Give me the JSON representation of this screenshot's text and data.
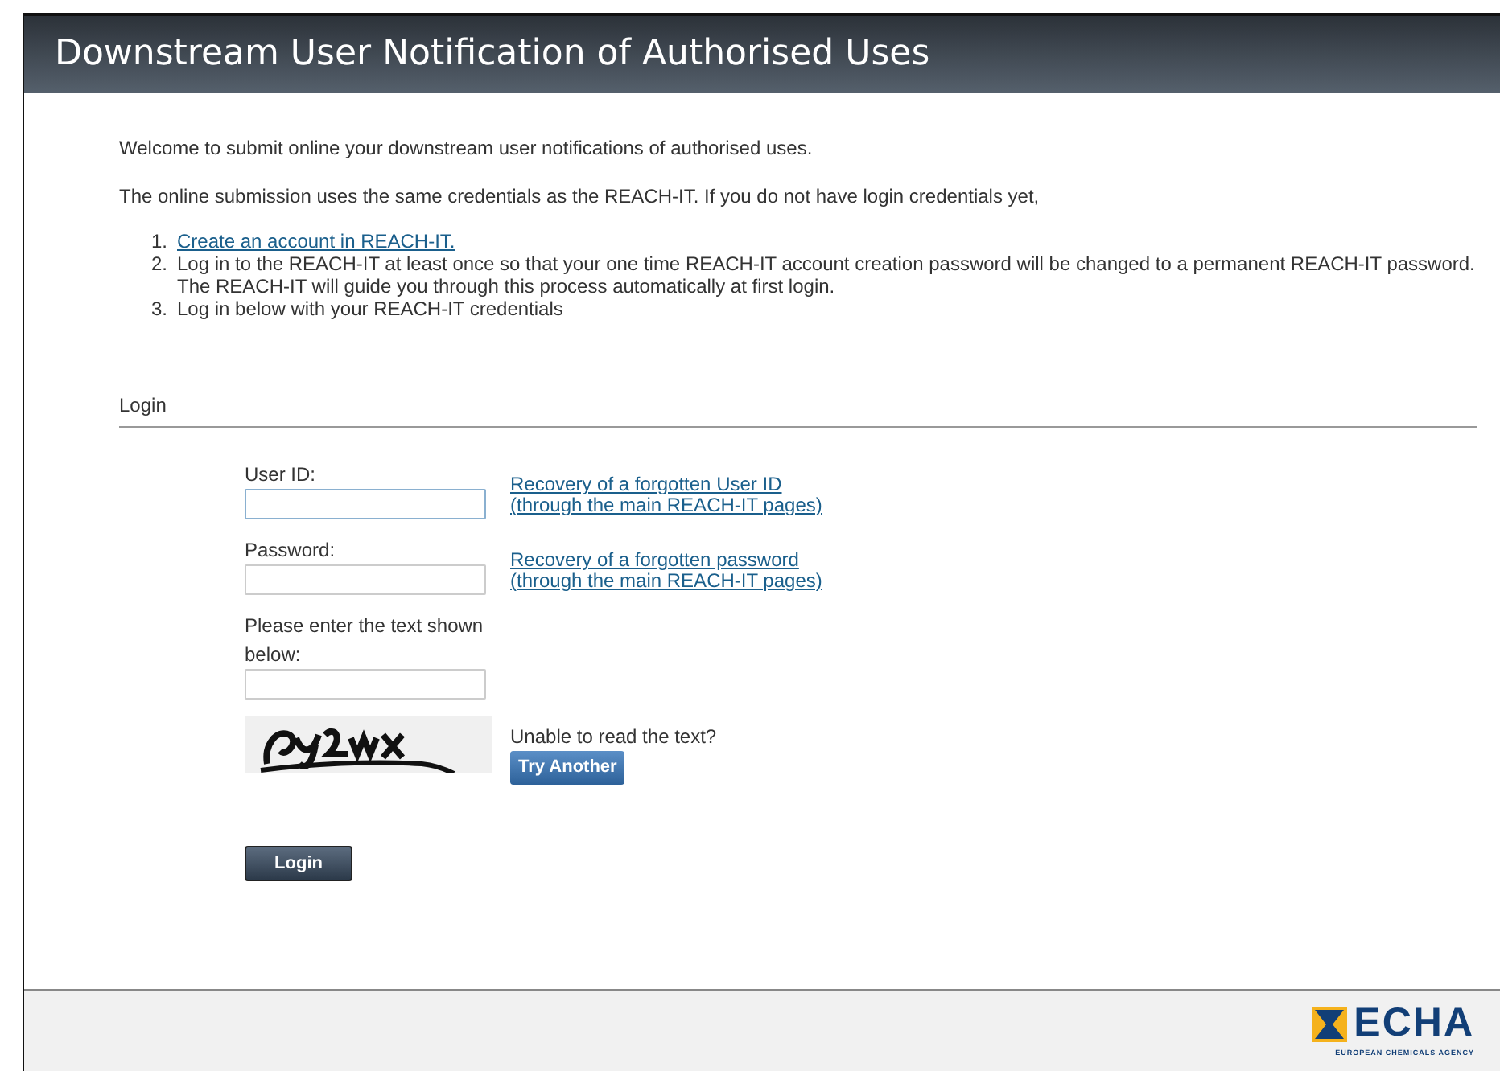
{
  "header": {
    "title": "Downstream User Notification of Authorised Uses"
  },
  "intro": [
    "Welcome to submit online your downstream user notifications of authorised uses.",
    "The online submission uses the same credentials as the REACH-IT. If you do not have login credentials yet,"
  ],
  "steps": [
    {
      "number": "1.",
      "text": "Create an account in REACH-IT.",
      "kind": "link"
    },
    {
      "number": "2.",
      "text": "Log in to the REACH-IT at least once so that your one time REACH-IT account creation password will be changed to a permanent REACH-IT password. The REACH-IT will guide you through this process automatically at first login.",
      "kind": "text"
    },
    {
      "number": "3.",
      "text": "Log in below with your REACH-IT credentials",
      "kind": "text"
    }
  ],
  "login_section": {
    "title": "Login"
  },
  "fields": [
    {
      "label": "User ID:",
      "focused": true,
      "link": [
        "Recovery of a forgotten User ID",
        "(through the main REACH-IT pages)"
      ]
    },
    {
      "label": "Password:",
      "focused": false,
      "link": [
        "Recovery of a forgotten password",
        "(through the main REACH-IT pages)"
      ]
    },
    {
      "label": "Please enter the text shown below:",
      "focused": false
    }
  ],
  "captcha": {
    "prompt": "Unable to read the text?",
    "button": "Try Another"
  },
  "login_button": "Login",
  "footer": {
    "logo": "ECHA",
    "logo_subtitle": "EUROPEAN CHEMICALS AGENCY"
  }
}
